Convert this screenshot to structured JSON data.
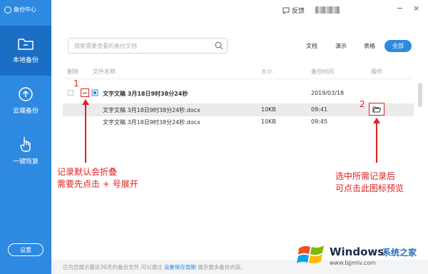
{
  "app": {
    "title": "备份中心"
  },
  "sidebar": {
    "items": [
      {
        "label": "本地备份",
        "icon": "folder-icon",
        "active": true
      },
      {
        "label": "云端备份",
        "icon": "cloud-upload-icon",
        "active": false
      },
      {
        "label": "一键恢复",
        "icon": "hand-pointer-icon",
        "active": false
      }
    ],
    "settings_label": "设置"
  },
  "topbar": {
    "feedback_label": "反馈",
    "minimize": "−",
    "close": "×"
  },
  "search": {
    "placeholder": "搜索需要查看的备份文档"
  },
  "filters": [
    {
      "label": "文档",
      "active": false
    },
    {
      "label": "演示",
      "active": false
    },
    {
      "label": "表格",
      "active": false
    },
    {
      "label": "全部",
      "active": true
    }
  ],
  "table": {
    "headers": {
      "delete": "删除",
      "name": "文件名称",
      "size": "大小",
      "time": "备份时间",
      "action": "操作"
    },
    "group": {
      "title": "文字文稿 3月18日9时38分24秒",
      "date": "2019/03/18"
    },
    "rows": [
      {
        "name": "文字文稿 3月18日9时38分24秒.docx",
        "size": "10KB",
        "time": "09:41"
      },
      {
        "name": "文字文稿 3月18日9时38分24秒.docx",
        "size": "10KB",
        "time": "09:45"
      }
    ]
  },
  "annotations": {
    "num1": "1",
    "num2": "2",
    "left_line1": "记录默认会折叠",
    "left_line2": "需要先点击 + 号展开",
    "right_line1": "选中所需记录后",
    "right_line2": "可点击此图标预览",
    "color": "#e02020"
  },
  "footer": {
    "prefix": "已为您展示最近30天的备份文件,可以通过 ",
    "link": "设置保存周期",
    "suffix": " 展示更多备份内容。"
  },
  "watermark": {
    "brand": "Windows",
    "cn": "系统之家",
    "url": "www.bjjmlv.com"
  },
  "colors": {
    "accent": "#2d8ae0",
    "sidebar_active": "#1a6fc4",
    "annotation": "#e02020"
  }
}
